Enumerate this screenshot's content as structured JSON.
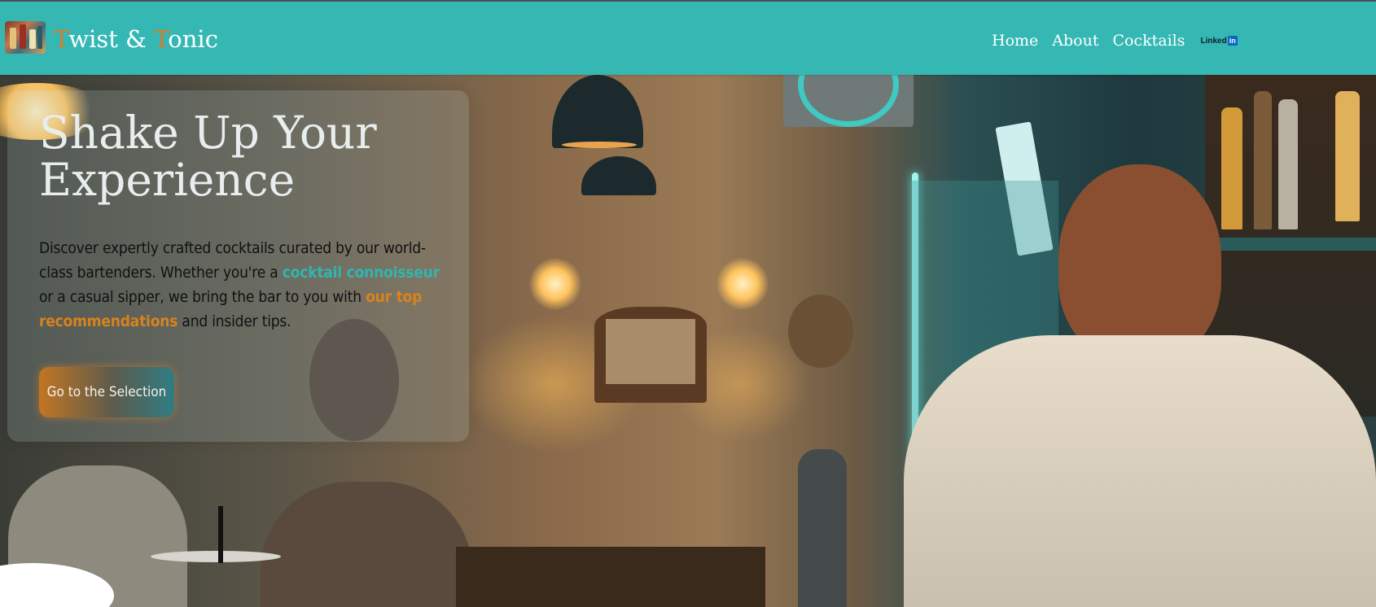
{
  "navbar": {
    "brand": {
      "first_letter_1": "T",
      "part_1": "wist & ",
      "first_letter_2": "T",
      "part_2": "onic"
    },
    "links": [
      {
        "label": "Home"
      },
      {
        "label": "About"
      },
      {
        "label": "Cocktails"
      }
    ],
    "linkedin": {
      "text": "Linked",
      "badge": "in"
    }
  },
  "hero": {
    "title_line_1": "Shake Up Your",
    "title_line_2": "Experience",
    "description": {
      "part_1": "Discover expertly crafted cocktails curated by our world-class bartenders. Whether you're a ",
      "highlight_1": "cocktail connoisseur",
      "part_2": " or a casual sipper, we bring the bar to you with ",
      "highlight_2": "our top recommendations",
      "part_3": " and insider tips."
    },
    "cta_label": "Go to the Selection"
  },
  "colors": {
    "navbar_bg": "#35b8b4",
    "brand_accent": "#e07a1e",
    "highlight_teal": "#2fb6b0",
    "highlight_orange": "#d9831b"
  }
}
